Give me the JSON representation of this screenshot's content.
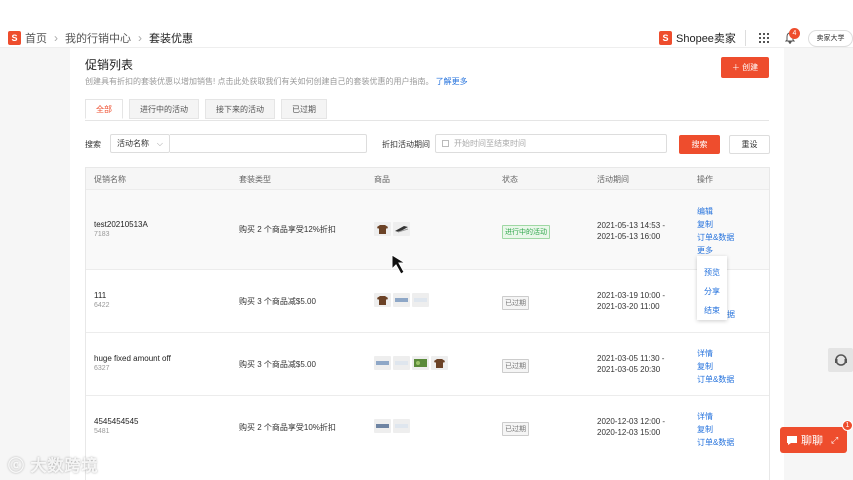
{
  "breadcrumb": {
    "home": "首页",
    "marketing": "我的行销中心",
    "current": "套装优惠"
  },
  "header": {
    "brand": "Shopee卖家",
    "notification_count": "4",
    "user_label": "卖家大学"
  },
  "page": {
    "title": "促销列表",
    "subtitle": "创建具有折扣的套装优惠以增加销售! 点击此处获取我们有关如何创建自己的套装优惠的用户指南。",
    "learn_more": "了解更多",
    "create_label": "创建"
  },
  "tabs": [
    {
      "label": "全部",
      "active": true
    },
    {
      "label": "进行中的活动",
      "active": false
    },
    {
      "label": "接下来的活动",
      "active": false
    },
    {
      "label": "已过期",
      "active": false
    }
  ],
  "filters": {
    "search_label": "搜索",
    "search_field": "活动名称",
    "period_label": "折扣活动期间",
    "period_placeholder": "开始时间至结束时间",
    "search_button": "搜索",
    "reset_button": "重设"
  },
  "table": {
    "headers": [
      "促销名称",
      "套装类型",
      "商品",
      "状态",
      "活动期间",
      "操作"
    ],
    "rows": [
      {
        "name": "test20210513A",
        "id": "7183",
        "type": "购买 2 个商品享受12%折扣",
        "status": "进行中的活动",
        "status_kind": "ongoing",
        "start": "2021-05-13 14:53 -",
        "end": "2021-05-13 16:00",
        "ops": [
          "编辑",
          "复制",
          "订单&数据",
          "更多"
        ]
      },
      {
        "name": "111",
        "id": "6422",
        "type": "购买 3 个商品减$5.00",
        "status": "已过期",
        "status_kind": "expired",
        "start": "2021-03-19 10:00 -",
        "end": "2021-03-20 11:00",
        "ops": [
          "据"
        ]
      },
      {
        "name": "huge fixed amount off",
        "id": "6327",
        "type": "购买 3 个商品减$5.00",
        "status": "已过期",
        "status_kind": "expired",
        "start": "2021-03-05 11:30 -",
        "end": "2021-03-05 20:30",
        "ops": [
          "详情",
          "复制",
          "订单&数据"
        ]
      },
      {
        "name": "4545454545",
        "id": "5481",
        "type": "购买 2 个商品享受10%折扣",
        "status": "已过期",
        "status_kind": "expired",
        "start": "2020-12-03 12:00 -",
        "end": "2020-12-03 15:00",
        "ops": [
          "详情",
          "复制",
          "订单&数据"
        ]
      }
    ]
  },
  "more_menu": [
    "预览",
    "分享",
    "结束"
  ],
  "chat": {
    "label": "聊聊",
    "badge": "1"
  },
  "watermark": "大数跨境",
  "colors": {
    "accent": "#ee4d2d",
    "link": "#2673dd",
    "ongoing": "#30a74c"
  }
}
